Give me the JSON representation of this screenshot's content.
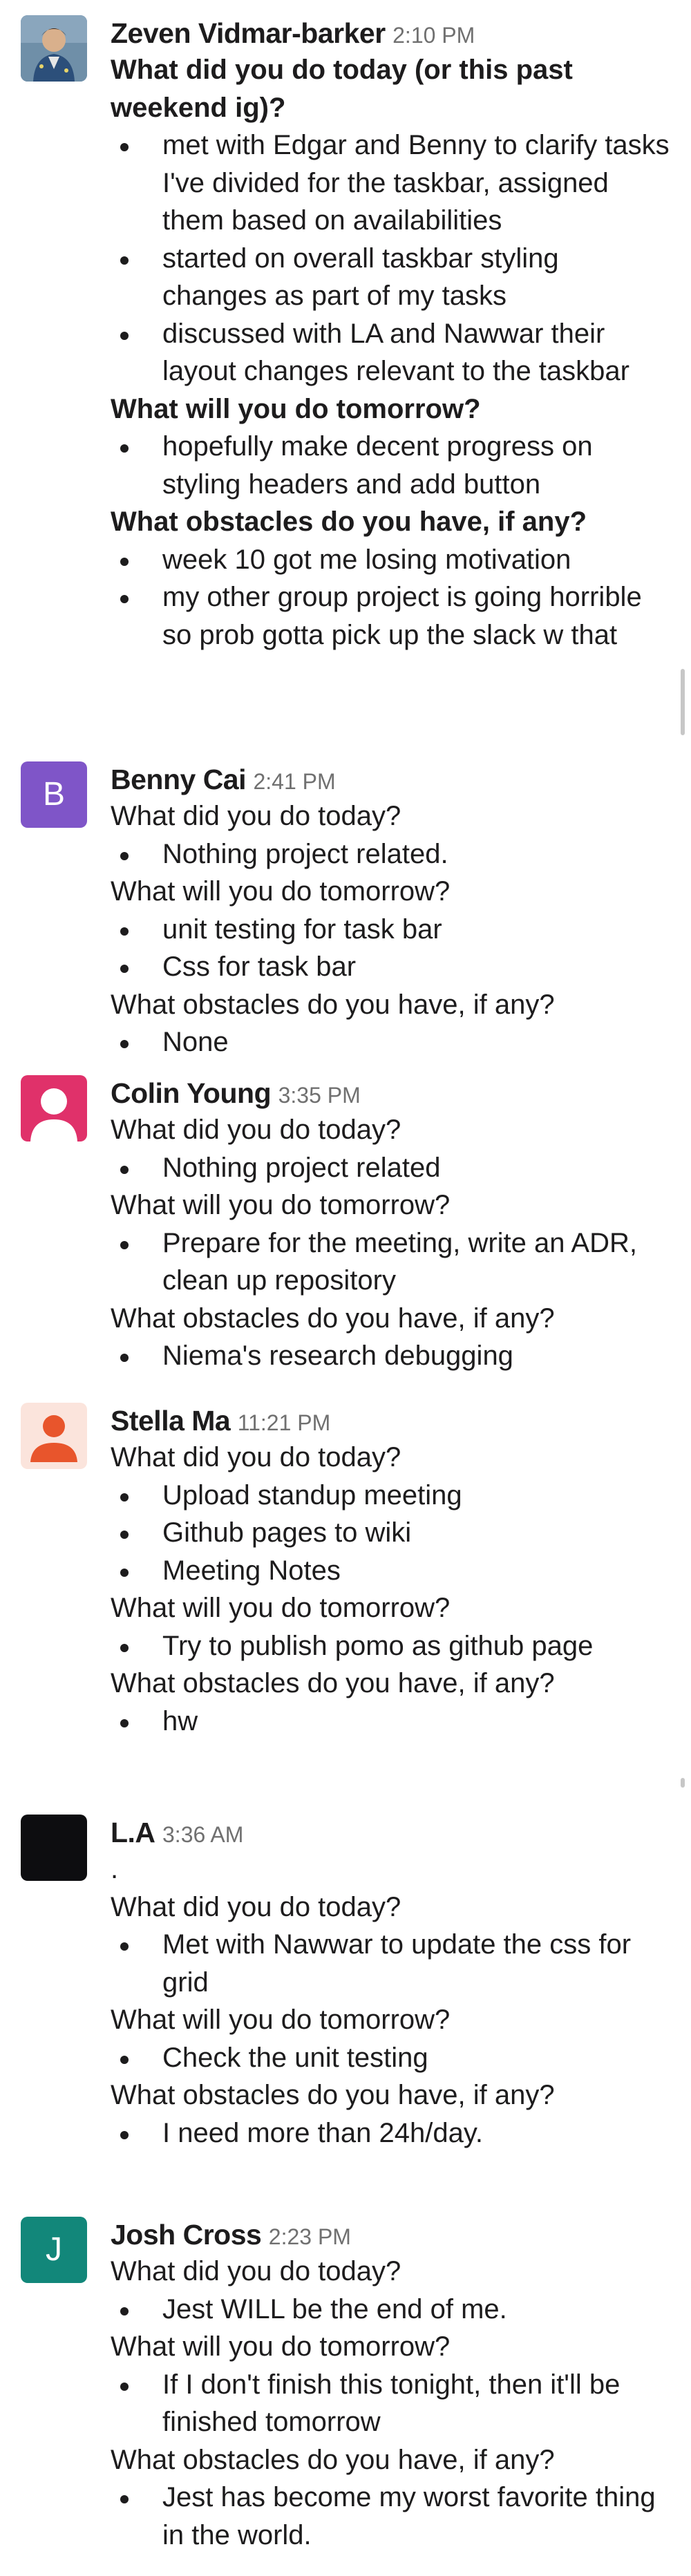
{
  "colors": {
    "benny_avatar": "#7f55c8",
    "colin_avatar": "#e0316a",
    "stella_avatar": "#e8552c",
    "josh_avatar": "#12877a",
    "la_avatar": "#0d0d10",
    "timestamp": "#707070",
    "text": "#1d1c1d"
  },
  "messages": [
    {
      "author": "Zeven Vidmar-barker",
      "time": "2:10 PM",
      "avatar": {
        "type": "photo"
      },
      "q1": "What did you do today (or this past weekend ig)?",
      "a1": [
        "met with Edgar and Benny to clarify tasks I've divided for the taskbar, assigned them based on availabilities",
        "started on overall taskbar styling changes as part of my tasks",
        "discussed with LA and Nawwar their layout changes relevant to the taskbar"
      ],
      "q2": "What will you do tomorrow?",
      "a2": [
        "hopefully make decent progress on styling headers and add button"
      ],
      "q3": "What obstacles do you have, if any?",
      "a3": [
        "week 10 got me losing motivation",
        "my other group project is going horrible so prob gotta pick up the slack w that"
      ]
    },
    {
      "author": "Benny Cai",
      "time": "2:41 PM",
      "avatar": {
        "type": "letter",
        "letter": "B"
      },
      "q1": "What did you do today?",
      "a1": [
        "Nothing project related."
      ],
      "q2": "What will you do tomorrow?",
      "a2": [
        "unit testing for task bar",
        "Css for task bar"
      ],
      "q3": "What obstacles do you have, if any?",
      "a3": [
        "None"
      ]
    },
    {
      "author": "Colin Young",
      "time": "3:35 PM",
      "avatar": {
        "type": "person-icon"
      },
      "q1": "What did you do today?",
      "a1": [
        "Nothing project related"
      ],
      "q2": "What will you do tomorrow?",
      "a2": [
        "Prepare for the meeting, write an ADR, clean up repository"
      ],
      "q3": "What obstacles do you have, if any?",
      "a3": [
        "Niema's research debugging"
      ]
    },
    {
      "author": "Stella Ma",
      "time": "11:21 PM",
      "avatar": {
        "type": "person-icon"
      },
      "q1": "What did you do today?",
      "a1": [
        "Upload standup meeting",
        "Github pages to wiki",
        "Meeting Notes"
      ],
      "q2": "What will you do tomorrow?",
      "a2": [
        "Try to publish pomo as github page"
      ],
      "q3": "What obstacles do you have, if any?",
      "a3": [
        "hw"
      ]
    },
    {
      "author": "L.A",
      "time": "3:36 AM",
      "avatar": {
        "type": "dark"
      },
      "pre": ".",
      "q1": "What did you do today?",
      "a1": [
        "Met with Nawwar to update the css for grid"
      ],
      "q2": "What will you do tomorrow?",
      "a2": [
        "Check the unit testing"
      ],
      "q3": "What obstacles do you have, if any?",
      "a3": [
        "I need more than 24h/day."
      ]
    },
    {
      "author": "Josh Cross",
      "time": "2:23 PM",
      "avatar": {
        "type": "letter",
        "letter": "J"
      },
      "q1": "What did you do today?",
      "a1": [
        "Jest WILL be the end of me."
      ],
      "q2": "What will you do tomorrow?",
      "a2": [
        "If I don't finish this tonight, then it'll be finished tomorrow"
      ],
      "q3": "What obstacles do you have, if any?",
      "a3": [
        "Jest has become my worst favorite thing in the world."
      ]
    }
  ]
}
